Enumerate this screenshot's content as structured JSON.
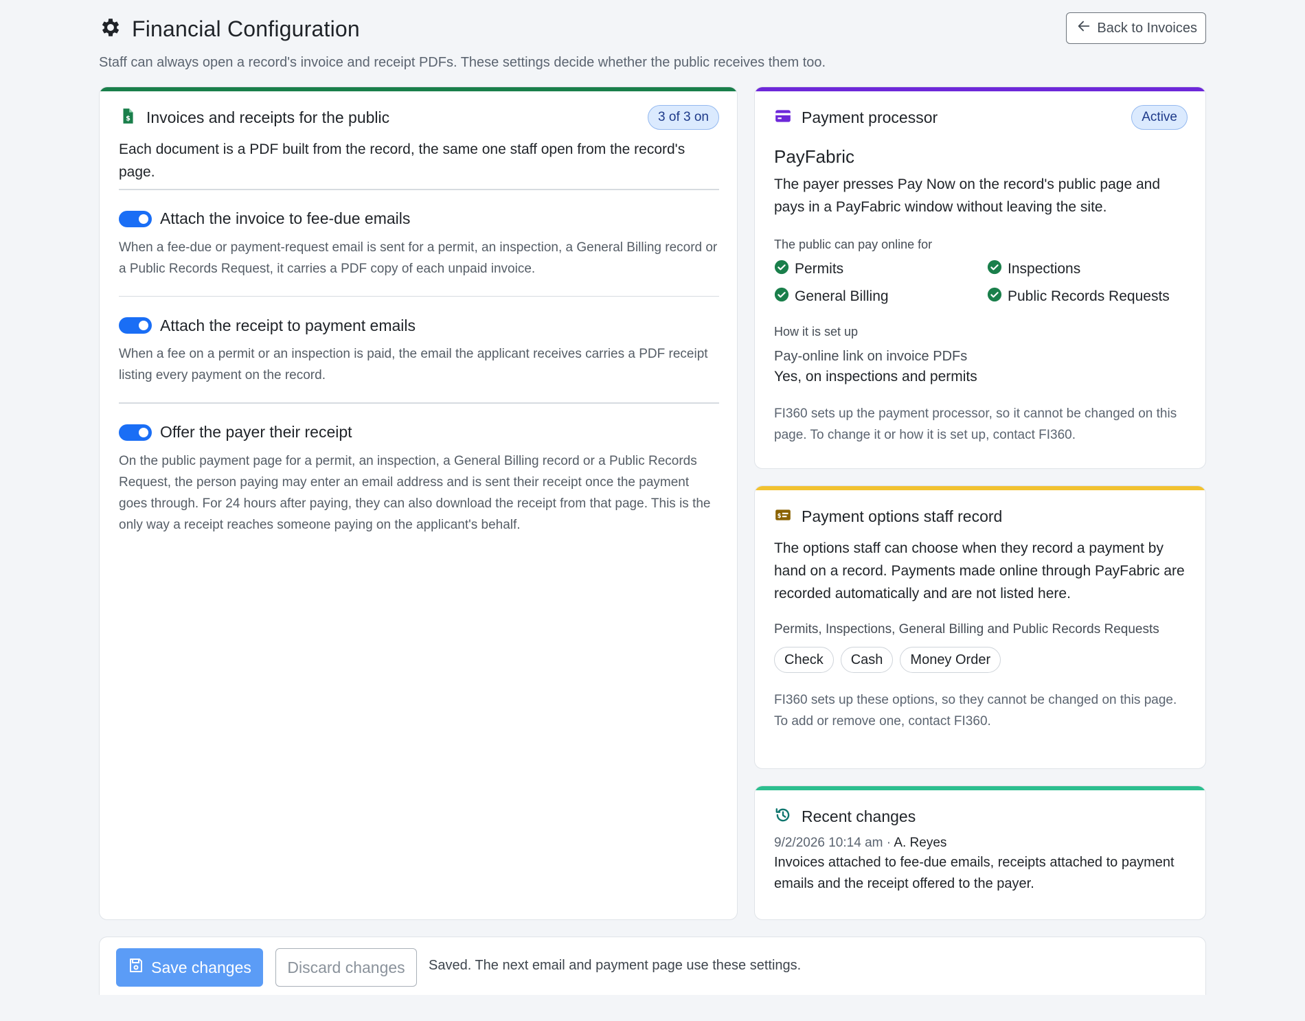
{
  "header": {
    "title": "Financial Configuration",
    "subtitle": "Staff can always open a record's invoice and receipt PDFs. These settings decide whether the public receives them too.",
    "back_label": "Back to Invoices"
  },
  "public_docs": {
    "title": "Invoices and receipts for the public",
    "badge": "3 of 3 on",
    "lead": "Each document is a PDF built from the record, the same one staff open from the record's page.",
    "toggles": [
      {
        "label": "Attach the invoice to fee-due emails",
        "on": true,
        "description": "When a fee-due or payment-request email is sent for a permit, an inspection, a General Billing record or a Public Records Request, it carries a PDF copy of each unpaid invoice."
      },
      {
        "label": "Attach the receipt to payment emails",
        "on": true,
        "description": "When a fee on a permit or an inspection is paid, the email the applicant receives carries a PDF receipt listing every payment on the record."
      },
      {
        "label": "Offer the payer their receipt",
        "on": true,
        "description": "On the public payment page for a permit, an inspection, a General Billing record or a Public Records Request, the person paying may enter an email address and is sent their receipt once the payment goes through. For 24 hours after paying, they can also download the receipt from that page. This is the only way a receipt reaches someone paying on the applicant's behalf."
      }
    ]
  },
  "processor": {
    "title": "Payment processor",
    "badge": "Active",
    "vendor": "PayFabric",
    "description": "The payer presses Pay Now on the record's public page and pays in a PayFabric window without leaving the site.",
    "pay_online_label": "The public can pay online for",
    "pay_online_items": [
      "Permits",
      "Inspections",
      "General Billing",
      "Public Records Requests"
    ],
    "setup_label": "How it is set up",
    "setup_name": "Pay-online link on invoice PDFs",
    "setup_value": "Yes, on inspections and permits",
    "note": "FI360 sets up the payment processor, so it cannot be changed on this page. To change it or how it is set up, contact FI360."
  },
  "options": {
    "title": "Payment options staff record",
    "description": "The options staff can choose when they record a payment by hand on a record. Payments made online through PayFabric are recorded automatically and are not listed here.",
    "group_label": "Permits, Inspections, General Billing and Public Records Requests",
    "chips": [
      "Check",
      "Cash",
      "Money Order"
    ],
    "note": "FI360 sets up these options, so they cannot be changed on this page. To add or remove one, contact FI360."
  },
  "recent": {
    "title": "Recent changes",
    "timestamp": "9/2/2026 10:14 am",
    "separator": "·",
    "author": "A. Reyes",
    "summary": "Invoices attached to fee-due emails, receipts attached to payment emails and the receipt offered to the payer."
  },
  "footer": {
    "save_label": "Save changes",
    "discard_label": "Discard changes",
    "status": "Saved. The next email and payment page use these settings."
  },
  "colors": {
    "accent_green": "#1a7f4b",
    "accent_purple": "#6d28d9",
    "accent_yellow": "#f2c230",
    "accent_teal": "#2cbf8f",
    "toggle_blue": "#1a6ef5",
    "save_blue": "#5b9cf6"
  }
}
